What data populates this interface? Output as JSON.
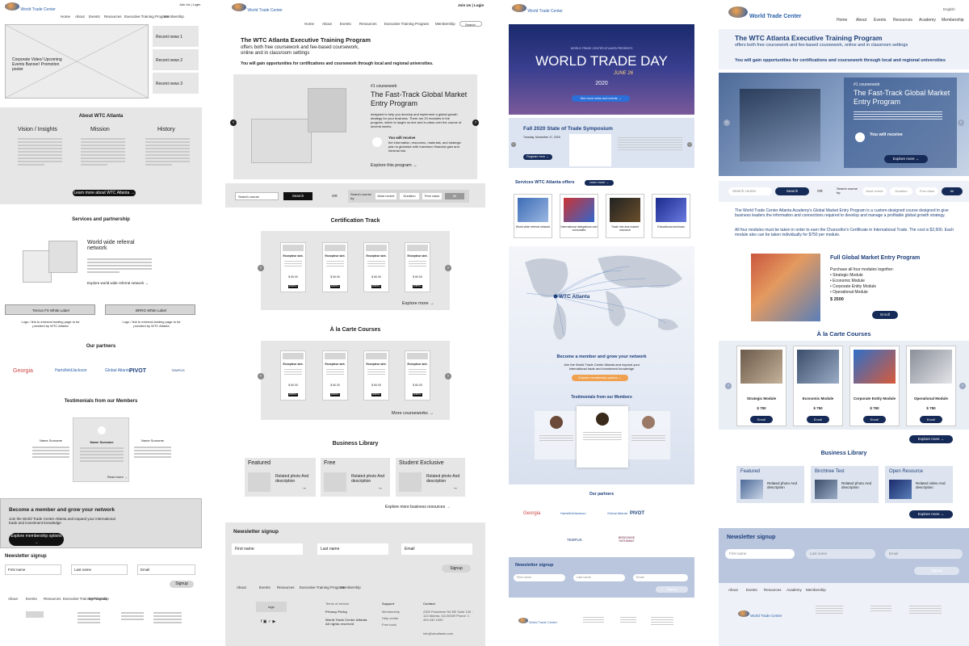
{
  "brand": {
    "name": "World Trade Center",
    "city": "Atlanta"
  },
  "p1": {
    "top_links": "Join Us | Login",
    "nav": [
      "Home",
      "About",
      "Events",
      "Resources",
      "Executive Training Program",
      "Membership"
    ],
    "hero_text": "Corporate Video/ Upcoming Events Banner/ Promotion poster",
    "recent_news": [
      "Recent news 1",
      "Recent news 2",
      "Recent news 3"
    ],
    "about_title": "About WTC Atlanta",
    "cols": [
      "Vision / Insights",
      "Mission",
      "History"
    ],
    "about_btn": "Learn more about WTC Atlanta →",
    "services_title": "Services and partnership",
    "referral_title": "World wide referral network",
    "referral_link": "Explore world wide referral network →",
    "label_boxes": [
      "Tenrus FX White Label",
      "BRRG White Label"
    ],
    "label_notes": [
      "Logo / link to external landing page to be provided by WTC Atlanta",
      "Logo / link to external landing page to be provided by WTC Atlanta"
    ],
    "partners_title": "Our partners",
    "partners": [
      "Georgia",
      "HartsfieldJackson",
      "Global Atlanta",
      "PIVOT",
      "TEMPUS"
    ],
    "testimonials_title": "Testimonials from our Members",
    "testimonial_names": [
      "Name Surname",
      "Name Surname",
      "Name Surname"
    ],
    "read_more": "Read more →",
    "member_title": "Become a member and grow your network",
    "member_text": "Join the World Trade Center Atlanta and expand your international trade and investment knowledge",
    "member_btn": "Explore membership options →",
    "newsletter_title": "Newsletter signup",
    "fields": [
      "First name",
      "Last name",
      "Email"
    ],
    "signup": "Signup",
    "footer_nav": [
      "About",
      "Events",
      "Resources",
      "Executive Training Program",
      "Membership"
    ]
  },
  "p2": {
    "top_links": "Join Us | Login",
    "nav": [
      "Home",
      "About",
      "Events",
      "Resources",
      "Executive Training Program",
      "Membership"
    ],
    "search": "Search",
    "title": "The WTC Atlanta Executive Training Program",
    "sub1": "offers both free coursework and fee-based coursework,",
    "sub2": "online and in classroom settings",
    "gain": "You will gain opportunities for certifications and coursework through local and regional universities.",
    "course_tag": "#1 coursework",
    "course_title": "The Fast-Track Global Market Entry Program",
    "course_desc": "designed to help you develop and implement a global growth strategy for your business. There are 20 modules in the program, which is taught on-line and in-class over the course of several weeks.",
    "receive": "You will receive",
    "receive_desc": "the information, resources, materials, and strategic plan to globalize with maximum financial gain and minimal risk.",
    "explore_program": "Explore this program",
    "search_course": "Search course",
    "search_btn": "Search",
    "or": "OR",
    "search_by": "Search course by:",
    "filters": [
      "Most recent",
      "Duration",
      "Free class",
      "All"
    ],
    "cert_title": "Certification Track",
    "card_title": "Excepteur sint.",
    "card_price": "$ 60.00",
    "enroll": "ENROLL",
    "explore_more": "Explore more",
    "alacarte_title": "À la Carte Courses",
    "more_coursework": "More courseworks",
    "library_title": "Business Library",
    "library": [
      {
        "label": "Featured",
        "desc": "Related photo And description"
      },
      {
        "label": "Free",
        "desc": "Related photo And description"
      },
      {
        "label": "Student Exclusive",
        "desc": "Related photo And description"
      }
    ],
    "more_resources": "Explore more business resources",
    "newsletter_title": "Newsletter signup",
    "fields": [
      "First name",
      "Last name",
      "Email"
    ],
    "signup": "Signup",
    "footer_nav": [
      "About",
      "Events",
      "Resources",
      "Executive Training Program",
      "Membership"
    ],
    "footer_cols": [
      "Terms of service",
      "Privacy Policy",
      "World Trade Center Atlanta All rights reserved",
      "Support",
      "Membership",
      "Help center",
      "Free tools",
      "Contact",
      "2300 Peachtree Rd NE Suite 120 - 122 Atlanta, GA 30309 Phone: 1 404 430 1000",
      "info@wtcatlanta.com"
    ],
    "logo": "logo"
  },
  "p3": {
    "hero_kicker": "WORLD TRADE CENTER ATLANTA PRESENTS",
    "hero_title": "WORLD TRADE DAY",
    "hero_date": "JUNE 26",
    "hero_year": "2020",
    "hero_btn": "See more news and events →",
    "event_title": "Fall 2020 State of Trade Symposium",
    "event_meta": "Tuesday, November 17, 2020",
    "event_btn": "Register here →",
    "services_title": "Services WTC Atlanta offers",
    "learn_more": "Learn more →",
    "services": [
      "World wide referral network",
      "International delegations and consulates",
      "Trade info and market research",
      "Educational seminars"
    ],
    "map_label": "WTC Atlanta",
    "member_title": "Become a member and grow your network",
    "member_text": "Join the World Trade Center Atlanta and expand your international trade and investment knowledge",
    "member_btn": "Explore membership options →",
    "testimonials_title": "Testimonials from our Members",
    "partners_title": "Our partners",
    "partners": [
      "Georgia",
      "HartsfieldJackson",
      "Global Atlanta",
      "PIVOT",
      "TEMPUS",
      "BERKSHIRE HATHAWAY"
    ],
    "newsletter_title": "Newsletter signup",
    "fields": [
      "First name",
      "Last name",
      "Email"
    ],
    "signup": "Signup"
  },
  "p4": {
    "top": "English",
    "nav": [
      "Home",
      "About",
      "Events",
      "Resources",
      "Academy",
      "Membership"
    ],
    "title": "The WTC Atlanta Executive Training Program",
    "sub": "offers both free coursework and fee-based coursework, online and in classroom settings",
    "gain": "You will gain opportunities for certifications and coursework through local and regional universities",
    "course_tag": "#1 coursework",
    "course_title": "The Fast-Track Global Market Entry Program",
    "receive": "You will receive",
    "explore_program": "Explore more →",
    "search_course": "Search course",
    "search_btn": "Search",
    "or": "OR",
    "search_by": "Search course by:",
    "filters": [
      "Most recent",
      "Duration",
      "Free class",
      "All"
    ],
    "intro1": "The World Trade Center Atlanta Academy's Global Market Entry Program is a custom-designed course designed to give business leaders the information and connections required to develop and manage a profitable global growth strategy.",
    "intro2": "All four modules must be taken in order to earn the Chancellor's Certificate in International Trade. The cost is $2,500. Each module also can be taken individually for $750 per module.",
    "full_title": "Full Global Market Entry Program",
    "full_sub": "Purchase all four modules together:",
    "full_list": [
      "• Strategic Module",
      "• Economic Module",
      "• Corporate Entity Module",
      "• Operational Module"
    ],
    "full_price": "$ 2500",
    "enroll": "Enroll",
    "alacarte_title": "À la Carte Courses",
    "modules": [
      {
        "name": "Strategic Module",
        "price": "$ 750"
      },
      {
        "name": "Economic Module",
        "price": "$ 750"
      },
      {
        "name": "Corporate Entity Module",
        "price": "$ 750"
      },
      {
        "name": "Operational Module",
        "price": "$ 750"
      }
    ],
    "explore_more": "Explore more →",
    "library_title": "Business Library",
    "library": [
      {
        "label": "Featured",
        "desc": "Related photo And description"
      },
      {
        "label": "Birchtree Test",
        "desc": "Related photo And description"
      },
      {
        "label": "Open Resource",
        "desc": "Related video And description"
      }
    ],
    "newsletter_title": "Newsletter signup",
    "fields": [
      "First name",
      "Last name",
      "Email"
    ],
    "signup": "Signup",
    "footer_nav": [
      "About",
      "Events",
      "Resources",
      "Academy",
      "Membership"
    ]
  }
}
